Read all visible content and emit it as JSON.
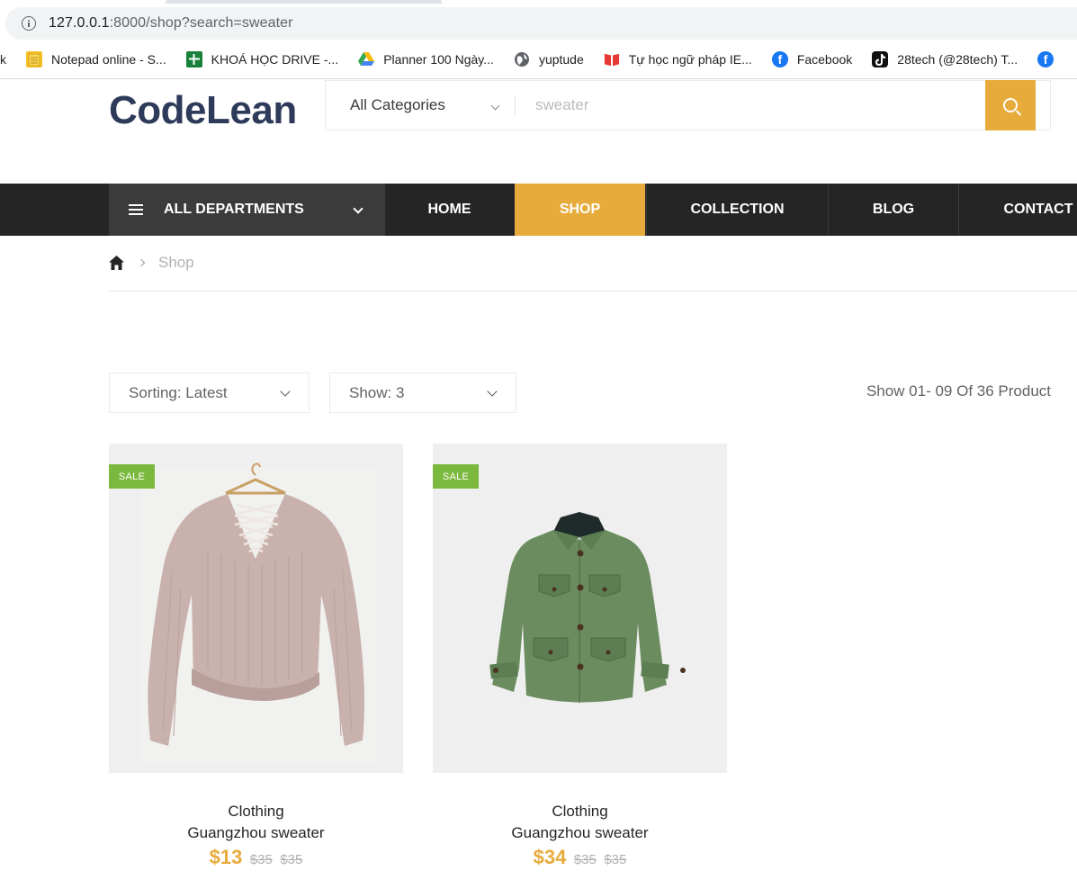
{
  "browser": {
    "url_host": "127.0.0.1",
    "url_rest": ":8000/shop?search=sweater",
    "bookmarks": [
      {
        "label": "Notepad online - S...",
        "icon": "notepad-icon",
        "color": "#f6c026"
      },
      {
        "label": "KHOÁ HỌC DRIVE -...",
        "icon": "sheets-icon",
        "color": "#188038"
      },
      {
        "label": "Planner 100 Ngày...",
        "icon": "drive-icon",
        "color": "#4285f4"
      },
      {
        "label": "yuptude",
        "icon": "globe-icon",
        "color": "#5f6368"
      },
      {
        "label": "Tự học ngữ pháp IE...",
        "icon": "book-icon",
        "color": "#e53935"
      },
      {
        "label": "Facebook",
        "icon": "facebook-icon",
        "color": "#1877f2"
      },
      {
        "label": "28tech (@28tech) T...",
        "icon": "tiktok-icon",
        "color": "#111111"
      }
    ],
    "cut_left": "k"
  },
  "header": {
    "logo": "CodeLean",
    "category": "All Categories",
    "search_value": "sweater"
  },
  "nav": {
    "departments": "ALL DEPARTMENTS",
    "items": [
      "HOME",
      "SHOP",
      "COLLECTION",
      "BLOG",
      "CONTACT"
    ],
    "active": "SHOP"
  },
  "breadcrumb": {
    "current": "Shop"
  },
  "filters": {
    "sorting": "Sorting: Latest",
    "show": "Show: 3",
    "count": "Show 01- 09 Of 36 Product"
  },
  "products": [
    {
      "badge": "SALE",
      "category": "Clothing",
      "name": "Guangzhou sweater",
      "price": "$13",
      "old1": "$35",
      "old2": "$35"
    },
    {
      "badge": "SALE",
      "category": "Clothing",
      "name": "Guangzhou sweater",
      "price": "$34",
      "old1": "$35",
      "old2": "$35"
    }
  ],
  "colors": {
    "accent": "#e7ab3c",
    "nav_bg": "#252525",
    "sale": "#7bb93e",
    "logo": "#2d3a59"
  }
}
